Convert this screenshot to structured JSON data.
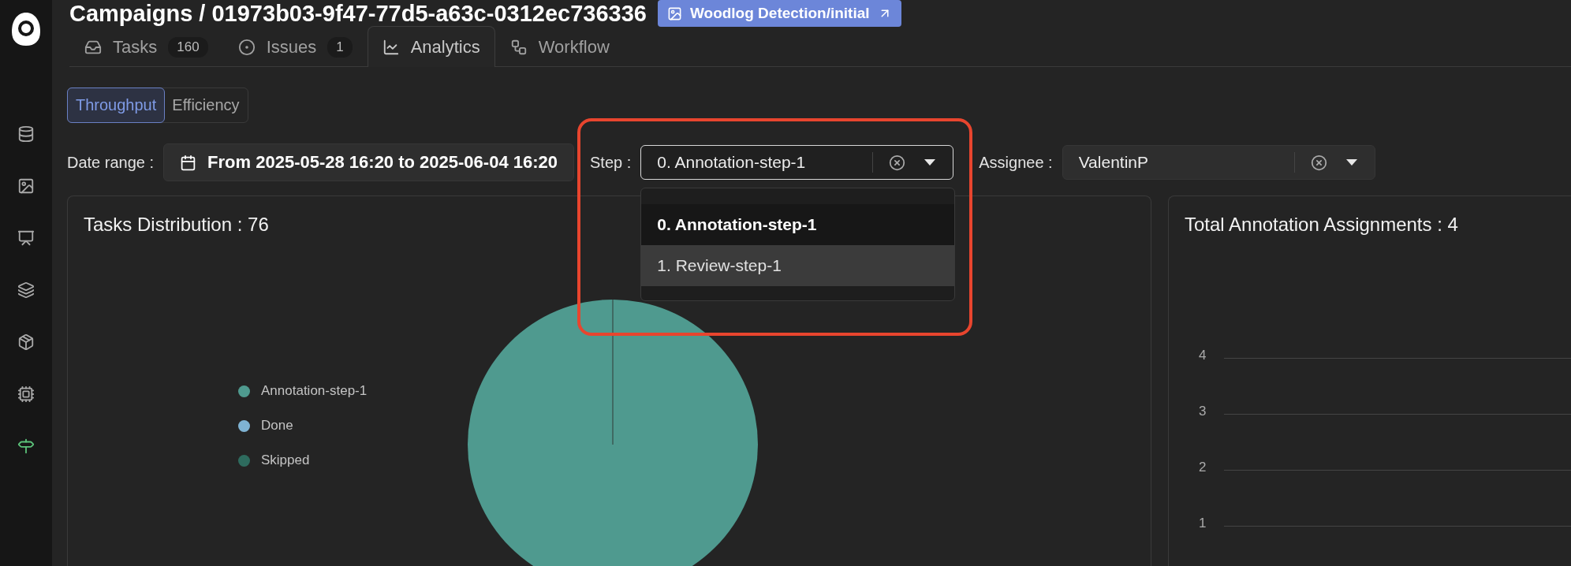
{
  "sidebar": {
    "items": [
      {
        "selected": false
      },
      {
        "selected": false
      },
      {
        "selected": false
      },
      {
        "selected": false
      },
      {
        "selected": false
      },
      {
        "selected": false
      },
      {
        "selected": true
      }
    ]
  },
  "header": {
    "title": "Campaigns / 01973b03-9f47-77d5-a63c-0312ec736336",
    "badge": "Woodlog Detection/initial"
  },
  "tabs": [
    {
      "label": "Tasks",
      "count": "160",
      "selected": false
    },
    {
      "label": "Issues",
      "count": "1",
      "selected": false
    },
    {
      "label": "Analytics",
      "selected": true
    },
    {
      "label": "Workflow",
      "selected": false
    }
  ],
  "view_switch": [
    {
      "label": "Throughput",
      "selected": true
    },
    {
      "label": "Efficiency",
      "selected": false
    }
  ],
  "filters": {
    "date_range": {
      "label": "Date range :",
      "value": "From 2025-05-28 16:20 to 2025-06-04 16:20"
    },
    "step": {
      "label": "Step :",
      "value": "0. Annotation-step-1",
      "expanded": true,
      "options": [
        {
          "label": "0. Annotation-step-1",
          "selected": true,
          "hovered": false
        },
        {
          "label": "1. Review-step-1",
          "selected": false,
          "hovered": true
        }
      ]
    },
    "assignee": {
      "label": "Assignee :",
      "value": "ValentinP"
    }
  },
  "tasks_distribution": {
    "title": "Tasks Distribution : 76",
    "legend": [
      {
        "label": "Annotation-step-1",
        "color": "#4f9a8f"
      },
      {
        "label": "Done",
        "color": "#7fb3d3"
      },
      {
        "label": "Skipped",
        "color": "#2e6b5e"
      }
    ]
  },
  "annotation_assignments": {
    "title": "Total Annotation Assignments : 4",
    "axis_labels": [
      "4",
      "3",
      "2",
      "1"
    ]
  }
}
